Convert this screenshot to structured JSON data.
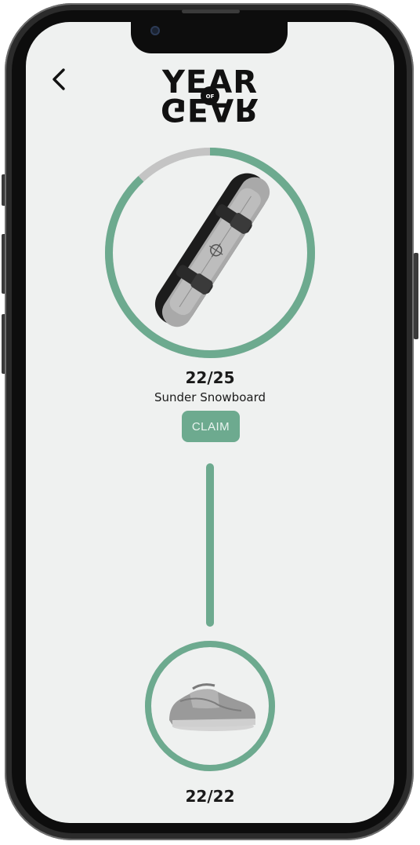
{
  "app": {
    "logo_top": "YEAR",
    "logo_of": "OF",
    "logo_bottom": "GEAR"
  },
  "colors": {
    "accent": "#6daa8f",
    "track": "#c4c4c4",
    "background": "#eff1f0",
    "text": "#1a1a1a"
  },
  "rewards": [
    {
      "item_name": "Sunder Snowboard",
      "progress_label": "22/25",
      "progress": 0.88,
      "claim_label": "CLAIM",
      "icon": "snowboard-icon"
    },
    {
      "item_name": "",
      "progress_label": "22/22",
      "progress": 1.0,
      "icon": "sneaker-icon"
    }
  ]
}
